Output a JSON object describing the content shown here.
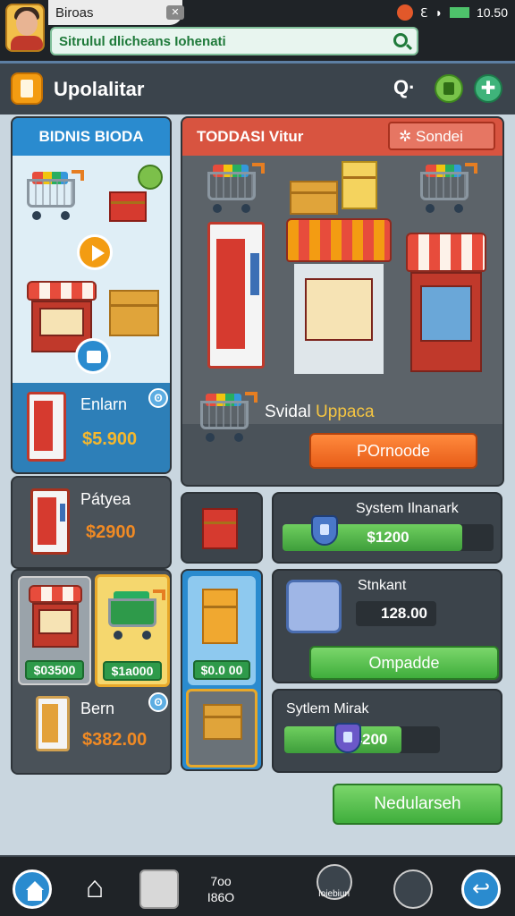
{
  "statusbar": {
    "tab_title": "Biroas",
    "tab_close": "✕",
    "time": "10.50",
    "signal_text": "ℇ",
    "url_text": "Sitrulul dlicheans Iohenati"
  },
  "header": {
    "title": "Upolalitar",
    "search_glyph": "Q·",
    "star_glyph": "✚"
  },
  "left_panel": {
    "title": "BIDNIS BIODA",
    "items": [
      {
        "title": "Enlarn",
        "price": "$5.900"
      },
      {
        "title": "Pátyea",
        "price": "$2900"
      },
      {
        "title": "Bern",
        "price": "$382.00"
      }
    ],
    "tiles": [
      {
        "price": "$03500"
      },
      {
        "price": "$1a000"
      }
    ],
    "info_glyph": "ʘ"
  },
  "right_panel": {
    "title": "TODDASI Vitur",
    "sort_label": "Sondei",
    "special_label_a": "Svidal",
    "special_label_b": "Uppaca",
    "button_label": "POrnoode",
    "tile_price": "$0.0 00",
    "stats": [
      {
        "title": "System Ilnanark",
        "value": "$1200",
        "fill": 0.85
      },
      {
        "title": "Stnkant",
        "value": "128.00",
        "fill": 0.45
      },
      {
        "title": "Sytlem Mirak",
        "value": "124200",
        "fill": 0.75
      }
    ],
    "ompadde_label": "Ompadde",
    "next_button": "Nedularseh"
  },
  "footer": {
    "center_text_top": "7oo",
    "center_text_bottom": "I86O",
    "label_small": "Ioiebiun"
  },
  "colors": {
    "accent_blue": "#2a8bcf",
    "accent_red": "#d85440",
    "accent_green": "#3fae3c",
    "accent_orange": "#e85d18",
    "price_gold": "#f5b82e"
  }
}
